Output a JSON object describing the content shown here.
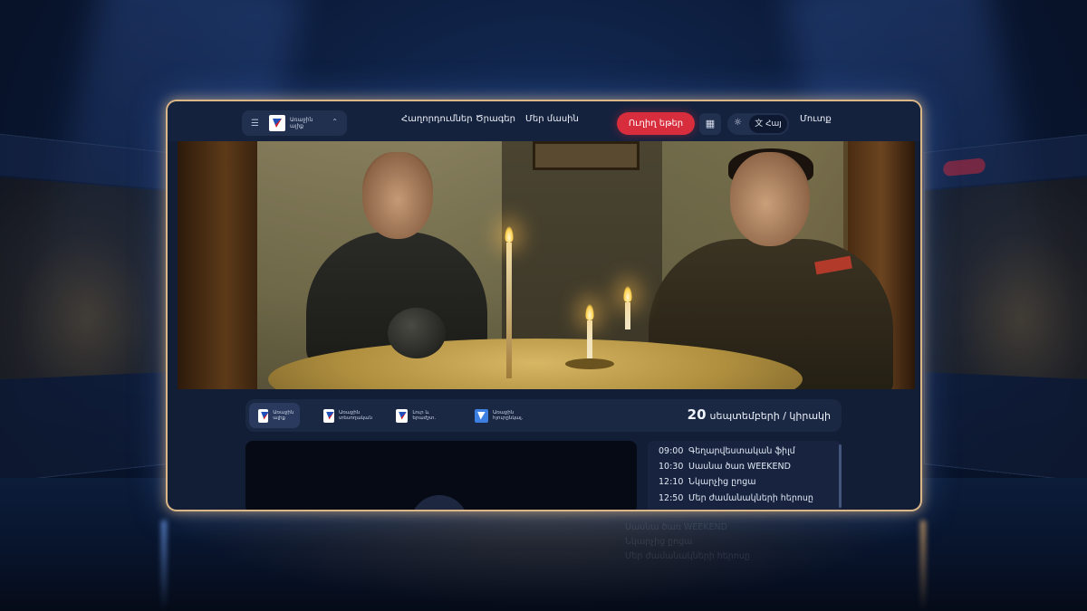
{
  "header": {
    "logo_text": "Առաջին ալիք",
    "nav": [
      "Հաղորդումներ",
      "Ծրագեր",
      "Մեր մասին"
    ],
    "live_button": "Ուղիղ եթեր",
    "language": "Հայ",
    "login": "Մուտք",
    "icons": [
      "menu-icon",
      "chevron-icon",
      "grid-icon",
      "sun-icon",
      "translate-icon"
    ]
  },
  "channels": [
    {
      "name": "Առաջին ալիք",
      "active": true
    },
    {
      "name": "Առաջին տեսողական"
    },
    {
      "name": "Լուր և երաժշտ."
    },
    {
      "name": "Առաջին հյուրընկալ."
    }
  ],
  "date": {
    "day": "20",
    "label": "սեպտեմբերի / կիրակի"
  },
  "schedule": [
    {
      "time": "09:00",
      "title": "Գեղարվեստական ֆիլմ"
    },
    {
      "time": "10:30",
      "title": "Սասնա ծառ WEEKEND"
    },
    {
      "time": "12:10",
      "title": "Նկարչից ըոցա"
    },
    {
      "time": "12:50",
      "title": "Մեր ժամանակների հերոսը"
    }
  ],
  "colors": {
    "accent_red": "#d72d3c",
    "panel": "#15223e",
    "frame_glow": "#ffd296"
  }
}
